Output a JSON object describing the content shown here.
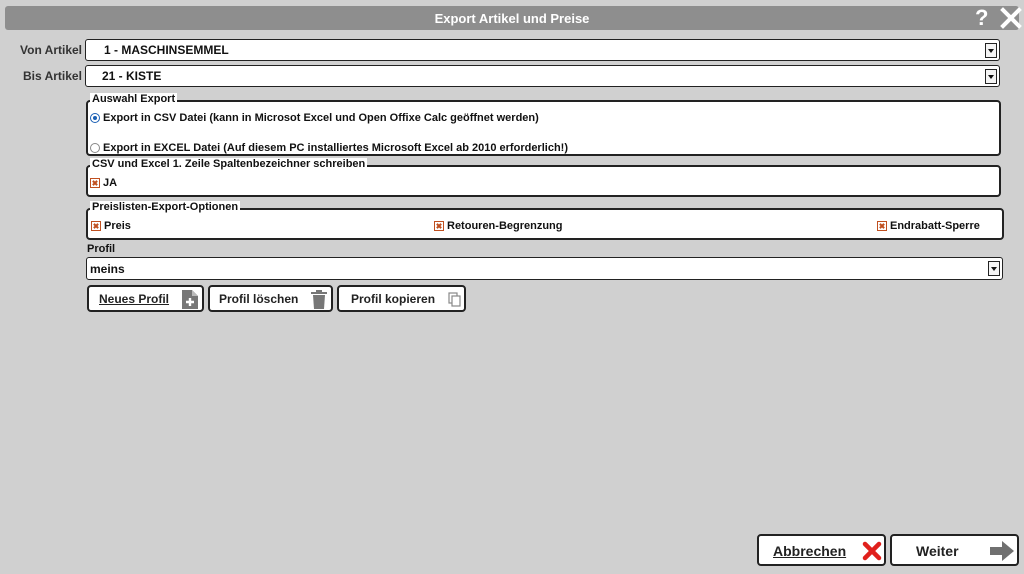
{
  "window": {
    "title": "Export Artikel und Preise",
    "help_icon": "?"
  },
  "von_artikel": {
    "label": "Von Artikel",
    "value": "1 - MASCHINSEMMEL"
  },
  "bis_artikel": {
    "label": "Bis Artikel",
    "value": "21 - KISTE"
  },
  "auswahl_export": {
    "legend": "Auswahl Export",
    "options": [
      {
        "label": "Export in CSV Datei (kann in Microsot Excel und Open Offixe Calc geöffnet werden)",
        "selected": true
      },
      {
        "label": "Export in EXCEL Datei (Auf diesem PC installiertes Microsoft Excel ab 2010 erforderlich!)",
        "selected": false
      }
    ]
  },
  "header_row": {
    "legend": "CSV und Excel 1. Zeile Spaltenbezeichner schreiben",
    "checkbox_label": "JA",
    "checked": true
  },
  "preisliste": {
    "legend": "Preislisten-Export-Optionen",
    "options": [
      {
        "label": "Preis",
        "checked": true
      },
      {
        "label": "Retouren-Begrenzung",
        "checked": true
      },
      {
        "label": "Endrabatt-Sperre",
        "checked": true
      }
    ]
  },
  "profil": {
    "label": "Profil",
    "value": "meins"
  },
  "profile_buttons": {
    "new": "Neues Profil",
    "delete": "Profil löschen",
    "copy": "Profil kopieren"
  },
  "footer": {
    "cancel": "Abbrechen",
    "next": "Weiter"
  },
  "colors": {
    "titlebar": "#8e8e8e",
    "background": "#d0d0d0",
    "cancel_x": "#e0201c",
    "next_arrow": "#707070"
  }
}
